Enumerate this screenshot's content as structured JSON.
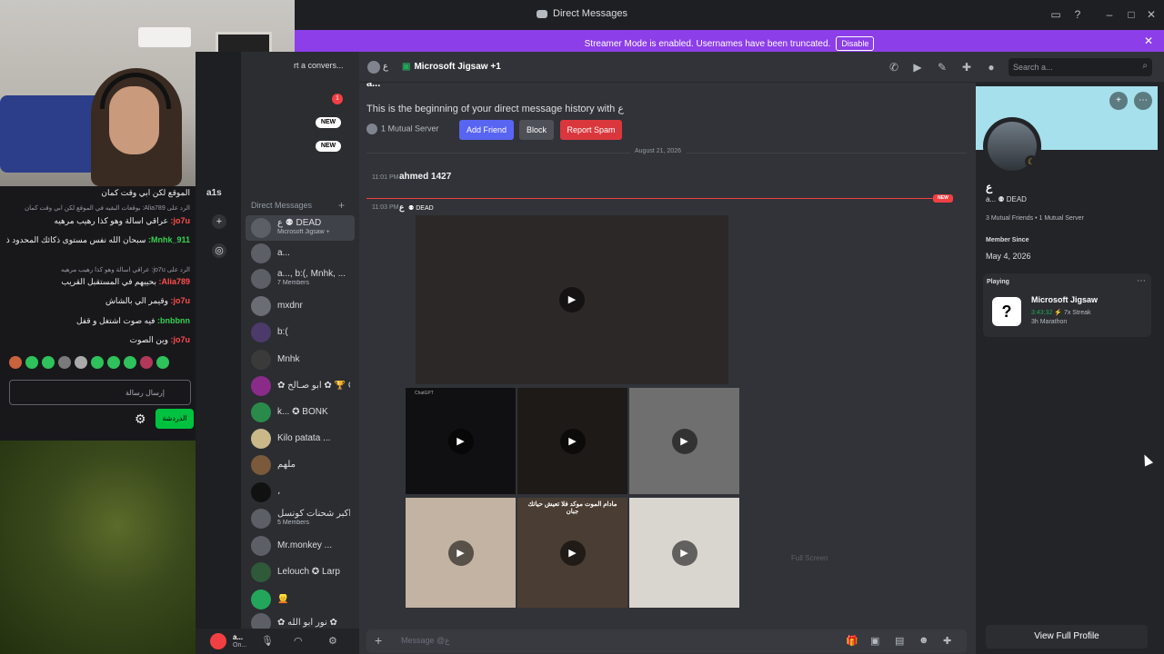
{
  "window": {
    "title": "Direct Messages"
  },
  "streamer": {
    "text": "Streamer Mode is enabled. Usernames have been truncated.",
    "button": "Disable"
  },
  "twitch_chat": {
    "lines": [
      {
        "kind": "text",
        "user": "",
        "text": "الموقع لكن ابي وقت كمان"
      },
      {
        "kind": "reply",
        "text": "الرد على Alia789: بوقعات البقيه في الموقع لكن ابي وقت كمان"
      },
      {
        "kind": "text",
        "user": "jo7u:",
        "text": "عراقي اسالة وهو كذا رهيب مرهيه"
      },
      {
        "kind": "text",
        "user": "Mnhk_911:",
        "text": "سبحان الله نفس مستوى ذكائك المحدود ذا البيت"
      },
      {
        "kind": "reply",
        "text": "الرد على jo7u: عراقي اسالة وهو كذا رهيب مرهيه"
      },
      {
        "kind": "text",
        "user": "Alia789:",
        "text": "بحيبهم في المستقبل القريب"
      },
      {
        "kind": "text",
        "user": "jo7u:",
        "text": "وقيمر الي بالشاش"
      },
      {
        "kind": "text",
        "user": "bnbbnn:",
        "text": "فيه صوت اشتغل و قفل"
      },
      {
        "kind": "text",
        "user": "jo7u:",
        "text": "وين الصوت"
      }
    ],
    "input_placeholder": "إرسال رسالة",
    "send_label": "الدردشة"
  },
  "rail": {
    "label": "a1s"
  },
  "dm_sidebar": {
    "find_label": "rt a convers...",
    "unread_count": "1",
    "new_badge": "NEW",
    "header": "Direct Messages",
    "items": [
      {
        "name": "ع ⚉ DEAD",
        "sub": "Microsoft Jigsaw +",
        "active": true
      },
      {
        "name": "a...",
        "sub": ""
      },
      {
        "name": "a..., b:(, Mnhk, ...",
        "sub": "7 Members"
      },
      {
        "name": "mxdnr",
        "sub": ""
      },
      {
        "name": "b:(",
        "sub": ""
      },
      {
        "name": "Mnhk",
        "sub": ""
      },
      {
        "name": "✿ أبو صـالح ✿ 🏆 Gi",
        "sub": ""
      },
      {
        "name": "k... ✪ BONK",
        "sub": ""
      },
      {
        "name": "Kilo patata ...",
        "sub": ""
      },
      {
        "name": "ملهم",
        "sub": ""
      },
      {
        "name": "،",
        "sub": ""
      },
      {
        "name": "من أكبر شحنات كونسل",
        "sub": "5 Members"
      },
      {
        "name": "Mr.monkey ...",
        "sub": ""
      },
      {
        "name": "Lelouch ✪ Larp",
        "sub": ""
      },
      {
        "name": "👱",
        "sub": ""
      },
      {
        "name": "✿ نور أبو الله ✿",
        "sub": ""
      }
    ]
  },
  "user_panel": {
    "name": "a...",
    "status": "On..."
  },
  "chat_header": {
    "name": "ع",
    "activity": "Microsoft Jigsaw +1",
    "search_placeholder": "Search a..."
  },
  "chat": {
    "top_cut": "a...",
    "intro": "This is the beginning of your direct message history with ع",
    "mutual": "1 Mutual Server",
    "buttons": {
      "add_friend": "Add Friend",
      "block": "Block",
      "report": "Report Spam"
    },
    "date_divider": "August 21, 2026",
    "messages": [
      {
        "time": "11:01 PM",
        "author": "ahmed 1427"
      },
      {
        "time": "11:03 PM",
        "author": "ع",
        "tag": "⚉ DEAD"
      }
    ],
    "new_label": "NEW",
    "video_thumb_caption": "ChatGPT",
    "video_thumb_text": "مادام الموت موكد فلا تعيش حياتك جبان",
    "full_screen": "Full Screen",
    "composer_placeholder": "Message @ع"
  },
  "profile": {
    "name": "ع",
    "sub": "a... ⚉ DEAD",
    "mutual": "3 Mutual Friends • 1 Mutual Server",
    "member_since_label": "Member Since",
    "member_since": "May 4, 2026",
    "playing_label": "Playing",
    "game": "Microsoft Jigsaw",
    "game_time": "3:43:32",
    "game_streak": "⚡ 7x Streak",
    "game_marathon": "3h Marathon",
    "view_full": "View Full Profile"
  },
  "colors": {
    "streamer_bar": "#8c3ee8",
    "add_friend": "#5865f2",
    "report": "#da373c",
    "online": "#23a55a",
    "twitch_green": "#00c240"
  }
}
